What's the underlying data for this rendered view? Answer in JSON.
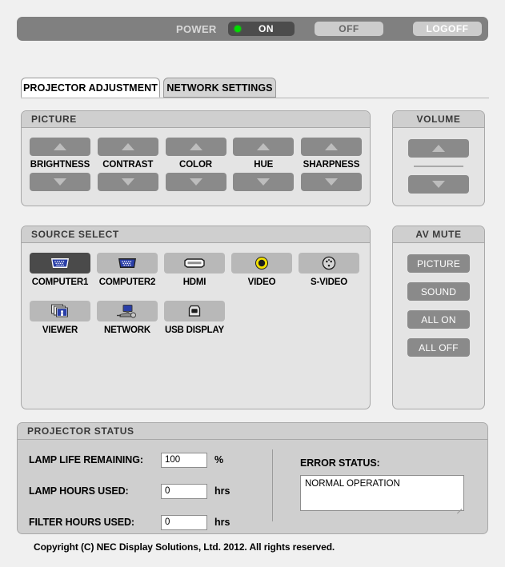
{
  "power": {
    "label": "POWER",
    "on_label": "ON",
    "off_label": "OFF",
    "logoff_label": "LOGOFF",
    "state": "ON",
    "led_color": "#00dd00",
    "bar_color": "#808080"
  },
  "tabs": [
    {
      "label": "PROJECTOR ADJUSTMENT",
      "active": true
    },
    {
      "label": "NETWORK SETTINGS",
      "active": false
    }
  ],
  "picture": {
    "title": "PICTURE",
    "controls": [
      {
        "label": "BRIGHTNESS"
      },
      {
        "label": "CONTRAST"
      },
      {
        "label": "COLOR"
      },
      {
        "label": "HUE"
      },
      {
        "label": "SHARPNESS"
      }
    ]
  },
  "volume": {
    "title": "VOLUME"
  },
  "source_select": {
    "title": "SOURCE SELECT",
    "selected": "COMPUTER1",
    "row1": [
      {
        "label": "COMPUTER1",
        "icon": "vga-connector-icon",
        "selected": true
      },
      {
        "label": "COMPUTER2",
        "icon": "vga-connector-icon",
        "selected": false
      },
      {
        "label": "HDMI",
        "icon": "hdmi-connector-icon",
        "selected": false
      },
      {
        "label": "VIDEO",
        "icon": "rca-composite-icon",
        "selected": false
      },
      {
        "label": "S-VIDEO",
        "icon": "svideo-connector-icon",
        "selected": false
      }
    ],
    "row2": [
      {
        "label": "VIEWER",
        "icon": "photos-stack-icon",
        "selected": false
      },
      {
        "label": "NETWORK",
        "icon": "network-monitor-icon",
        "selected": false
      },
      {
        "label": "USB DISPLAY",
        "icon": "usb-port-icon",
        "selected": false
      }
    ]
  },
  "av_mute": {
    "title": "AV MUTE",
    "buttons": [
      {
        "label": "PICTURE"
      },
      {
        "label": "SOUND"
      },
      {
        "label": "ALL ON"
      },
      {
        "label": "ALL OFF"
      }
    ]
  },
  "projector_status": {
    "title": "PROJECTOR STATUS",
    "rows": [
      {
        "name": "LAMP LIFE REMAINING:",
        "value": "100",
        "unit": "%"
      },
      {
        "name": "LAMP HOURS USED:",
        "value": "0",
        "unit": "hrs"
      },
      {
        "name": "FILTER HOURS USED:",
        "value": "0",
        "unit": "hrs"
      }
    ],
    "error_status_label": "ERROR STATUS:",
    "error_status_value": "NORMAL OPERATION"
  },
  "copyright": "Copyright (C) NEC Display Solutions, Ltd. 2012. All rights reserved."
}
